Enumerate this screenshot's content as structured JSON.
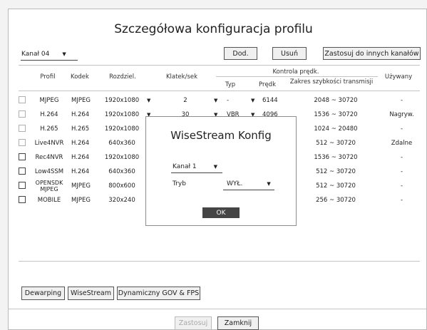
{
  "title": "Szczegółowa konfiguracja profilu",
  "channel_select": {
    "value": "Kanał 04"
  },
  "buttons": {
    "add": "Dod.",
    "remove": "Usuń",
    "apply_other": "Zastosuj do innych kanałów",
    "dewarping": "Dewarping",
    "wisestream": "WiseStream",
    "dynamic_gov": "Dynamiczny GOV & FPS",
    "apply": "Zastosuj",
    "close": "Zamknij"
  },
  "headers": {
    "profile": "Profil",
    "codec": "Kodek",
    "resolution": "Rozdziel.",
    "fps": "Klatek/sek",
    "bitrate_control": "Kontrola prędk.",
    "type": "Typ",
    "speed": "Prędk",
    "range": "Zakres szybkości transmisji",
    "used": "Używany"
  },
  "rows": [
    {
      "profile": "MJPEG",
      "codec": "MJPEG",
      "resolution": "1920x1080",
      "fps": "2",
      "type": "-",
      "speed": "6144",
      "range": "2048 ~ 30720",
      "used": "-",
      "enabled": false
    },
    {
      "profile": "H.264",
      "codec": "H.264",
      "resolution": "1920x1080",
      "fps": "30",
      "type": "VBR",
      "speed": "4096",
      "range": "1536 ~ 30720",
      "used": "Nagryw.",
      "enabled": false
    },
    {
      "profile": "H.265",
      "codec": "H.265",
      "resolution": "1920x1080",
      "fps": "",
      "type": "",
      "speed": "",
      "range": "1024 ~ 20480",
      "used": "-",
      "enabled": false
    },
    {
      "profile": "Live4NVR",
      "codec": "H.264",
      "resolution": "640x360",
      "fps": "",
      "type": "",
      "speed": "",
      "range": "512 ~ 30720",
      "used": "Zdalne",
      "enabled": false
    },
    {
      "profile": "Rec4NVR",
      "codec": "H.264",
      "resolution": "1920x1080",
      "fps": "",
      "type": "",
      "speed": "",
      "range": "1536 ~ 30720",
      "used": "-",
      "enabled": true
    },
    {
      "profile": "Low4SSM",
      "codec": "H.264",
      "resolution": "640x360",
      "fps": "",
      "type": "",
      "speed": "",
      "range": "512 ~ 30720",
      "used": "-",
      "enabled": true
    },
    {
      "profile": "OPENSDK MJPEG",
      "codec": "MJPEG",
      "resolution": "800x600",
      "fps": "",
      "type": "",
      "speed": "",
      "range": "512 ~ 30720",
      "used": "-",
      "enabled": true
    },
    {
      "profile": "MOBILE",
      "codec": "MJPEG",
      "resolution": "320x240",
      "fps": "",
      "type": "",
      "speed": "",
      "range": "256 ~ 30720",
      "used": "-",
      "enabled": true
    }
  ],
  "modal": {
    "title": "WiseStream Konfig",
    "channel_value": "Kanał 1",
    "mode_label": "Tryb",
    "mode_value": "WYŁ.",
    "ok": "OK"
  }
}
